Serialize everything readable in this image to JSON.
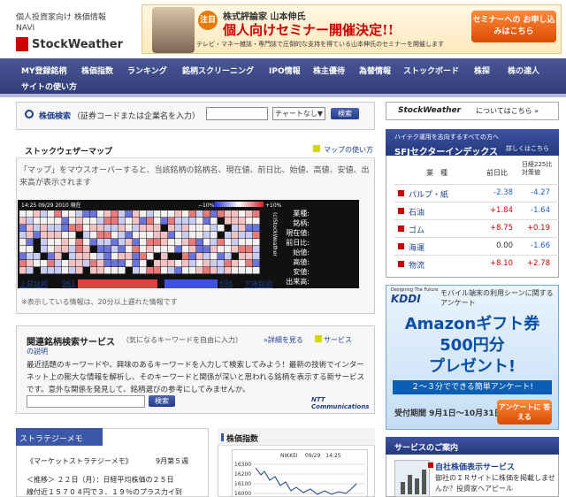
{
  "header": {
    "tagline_line1": "個人投資家向け 株価情報",
    "tagline_line2": "NAVI",
    "logo": "StockWeather",
    "banner": {
      "badge": "注目",
      "subtitle": "株式評論家 山本伸氏",
      "title": "個人向けセミナー開催決定!!",
      "note": "テレビ・マネー雑誌・専門誌で圧倒的な支持を得ている山本伸氏のセミナーを開催します",
      "cta": "セミナーへの お申し込みはこちら"
    }
  },
  "nav": {
    "items": [
      "MY登録銘柄",
      "株価指数",
      "ランキング",
      "銘柄スクリーニング",
      "IPO情報",
      "株主優待",
      "為替情報",
      "ストックボード",
      "株探",
      "株の達人"
    ],
    "second_row": "サイトの使い方"
  },
  "search": {
    "label": "株価検索",
    "hint": "（証券コードまたは企業名を入力）",
    "input_value": "",
    "select_value": "チャートなし",
    "button": "検索"
  },
  "stock_map": {
    "title": "ストックウェザーマップ",
    "help": "マップの使い方",
    "description": "「マップ」をマウスオーバーすると、当該銘柄の銘柄名、現在値、前日比、始値、高値、安値、出来高が表示されます",
    "timestamp": "14:25 09/29 2010 現在",
    "scale_left": "−10%",
    "scale_right": "+10%",
    "up_label": "上昇銘柄",
    "up_count": "961",
    "down_count": "696",
    "down_label": "下降銘柄",
    "info_labels": [
      "業種:",
      "銘柄:",
      "現在値:",
      "前日比:",
      "始値:",
      "高値:",
      "安値:",
      "出来高:"
    ],
    "brand_vertical": "(c)StockWeather",
    "note": "※表示している情報は、20分以上遅れた情報です"
  },
  "related": {
    "title": "関連銘柄検索サービス",
    "subtitle": "（気になるキーワードを自由に入力）",
    "more": "»詳細を見る",
    "service_link": "サービス",
    "help": "の説明",
    "description": "最近話題のキーワードや、興味のあるキーワードを入力して検索してみよう！最新の技術でインターネット上の膨大な情報を解析し、そのキーワードと関係が深いと思われる銘柄を表示する新サービスです。意外な関係を発見して、銘柄選びの参考にしてみませんか。",
    "button": "検索",
    "ntt": "NTT Communications"
  },
  "strategy": {
    "tab": "ストラテジーメモ",
    "headline": "《マーケットストラテジーメモ》",
    "week": "9月第５週",
    "line2": "＜推移＞ ２２日（月）：日経平均株価の２５日",
    "line3": "線付近１５７０４円で３．１９％のプラス力イ到"
  },
  "nikkei": {
    "title": "株価指数",
    "chart_title": "NIKKEI",
    "chart_time": "09/29　14:25",
    "y_ticks": [
      "16300",
      "16200",
      "16100",
      "16000"
    ]
  },
  "right": {
    "about_logo": "StockWeather",
    "about_text": "についてはこちら »",
    "sfj": {
      "sub": "ハイテク運用を志向するすべての方へ",
      "title": "SFJセクターインデックス",
      "detail": "詳しくはこちら",
      "col_sector": "業　種",
      "col_day": "前日比",
      "col_225": "日経225比対策値",
      "rows": [
        {
          "name": "パルプ・紙",
          "day": "-2.38",
          "n225": "-4.27"
        },
        {
          "name": "石油",
          "day": "+1.84",
          "n225": "-1.64"
        },
        {
          "name": "ゴム",
          "day": "+8.75",
          "n225": "+0.19"
        },
        {
          "name": "海運",
          "day": "0.00",
          "n225": "-1.66"
        },
        {
          "name": "物流",
          "day": "+8.10",
          "n225": "+2.78"
        }
      ]
    },
    "kddi": {
      "tag": "Designing The Future",
      "logo": "KDDI",
      "text": "モバイル端末の利用シーンに関するアンケート",
      "big1": "Amazonギフト券",
      "big2": "500円分",
      "big3": "プレゼント!",
      "bar": "２～３分でできる簡単アンケート!",
      "period": "受付期間 9月1日～10月31日",
      "cta": "アンケートに 答える"
    },
    "service": {
      "title": "サービスのご案内",
      "link": "自社株価表示サービス",
      "desc": "御社のＩＲサイトに株価を掲載しませんか？投資家へアピール"
    }
  },
  "colors": {
    "nav_bg": "#3b4787",
    "accent_orange": "#e0600c",
    "up_red": "#e34040",
    "down_blue": "#4050e0",
    "link_blue": "#1e3f8f"
  }
}
